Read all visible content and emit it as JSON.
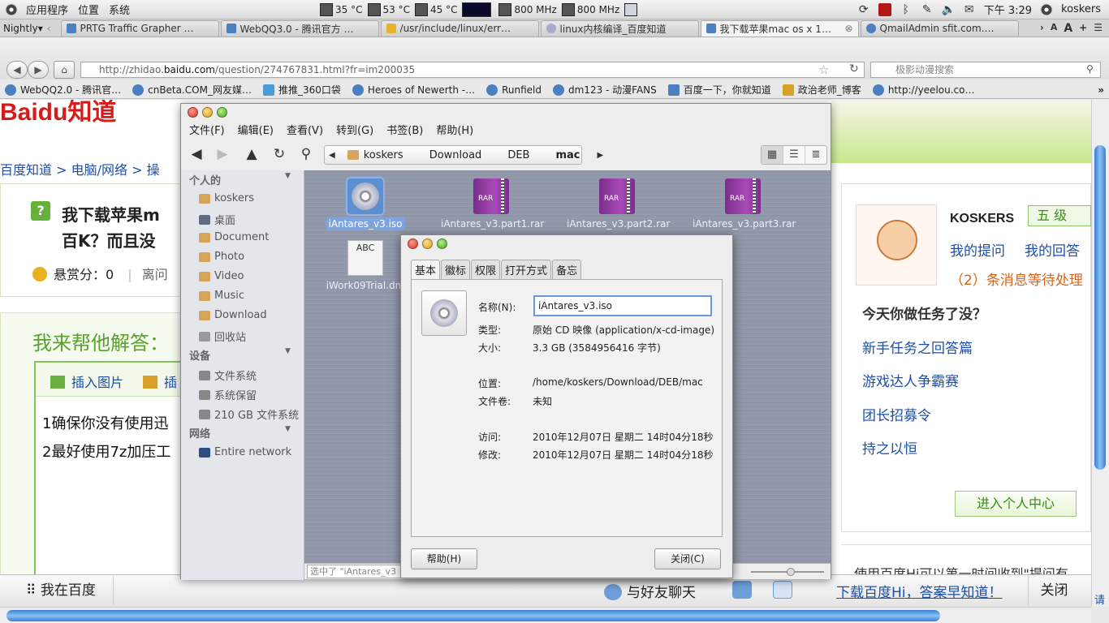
{
  "panel": {
    "menus": [
      "应用程序",
      "位置",
      "系统"
    ],
    "cpu_temp1": "35 °C",
    "cpu_temp2": "53 °C",
    "cpu_temp3": "45 °C",
    "freq1": "800 MHz",
    "freq2": "800 MHz",
    "clock": "下午 3:29",
    "user": "koskers"
  },
  "firefox": {
    "app_button": "Nightly",
    "tabs": [
      {
        "title": "PRTG Traffic Grapher …"
      },
      {
        "title": "WebQQ3.0 - 腾讯官方 …"
      },
      {
        "title": "/usr/include/linux/err…"
      },
      {
        "title": "linux内核编译_百度知道"
      },
      {
        "title": "我下载苹果mac os x 1…",
        "active": true
      },
      {
        "title": "QmailAdmin sfit.com.…"
      }
    ],
    "tab_tools": [
      "A",
      "A",
      "+"
    ],
    "url_prefix": "http://zhidao.",
    "url_domain": "baidu.com",
    "url_suffix": "/question/274767831.html?fr=im200035",
    "search_placeholder": "极影动漫搜索",
    "bookmarks": [
      "WebQQ2.0 - 腾讯官…",
      "cnBeta.COM_网友媒…",
      "推推_360口袋",
      "Heroes of Newerth -…",
      "Runfield",
      "dm123 - 动漫FANS",
      "百度一下，你就知道",
      "政治老师_博客",
      "http://yeelou.co…"
    ]
  },
  "baidu": {
    "logo": "Baidu知道",
    "breadcrumb": [
      "百度知道",
      "电脑/网络",
      "操"
    ],
    "question_title_l1": "我下载苹果m",
    "question_title_l2": "百K？而且没",
    "reward_label": "悬赏分：",
    "reward_value": "0",
    "reward_extra": "离问",
    "help_heading": "我来帮他解答：",
    "insert_image": "插入图片",
    "insert_more": "插",
    "answer_lines": [
      "1确保你没有使用迅",
      "2最好使用7z加压工"
    ],
    "user_name": "KOSKERS",
    "user_level": "五 级",
    "my_questions": "我的提问",
    "my_answers": "我的回答",
    "message_wait": "（2）条消息等待处理",
    "task_heading": "今天你做任务了没？",
    "tasks": [
      "新手任务之回答篇",
      "游戏达人争霸赛",
      "团长招募令",
      "持之以恒"
    ],
    "enter_center": "进入个人中心",
    "hi_text": "使用百度Hi可以第一时间收到\"提问有",
    "hibar_left": "我在百度",
    "hibar_chat": "与好友聊天",
    "hibar_download": "下载百度Hi，答案早知道！",
    "hibar_close": "关闭",
    "hibar_fragment": "请"
  },
  "nautilus": {
    "menu": [
      "文件(F)",
      "编辑(E)",
      "查看(V)",
      "转到(G)",
      "书签(B)",
      "帮助(H)"
    ],
    "path": [
      "koskers",
      "Download",
      "DEB",
      "mac"
    ],
    "sidebar": {
      "personal_header": "个人的",
      "personal": [
        "koskers",
        "桌面",
        "Document",
        "Photo",
        "Video",
        "Music",
        "Download",
        "回收站"
      ],
      "devices_header": "设备",
      "devices": [
        "文件系统",
        "系统保留",
        "210 GB 文件系统"
      ],
      "network_header": "网络",
      "network": [
        "Entire network"
      ]
    },
    "files": [
      {
        "name": "iAntares_v3.iso",
        "kind": "iso",
        "selected": true
      },
      {
        "name": "iAntares_v3.part1.rar",
        "kind": "rar"
      },
      {
        "name": "iAntares_v3.part2.rar",
        "kind": "rar"
      },
      {
        "name": "iAntares_v3.part3.rar",
        "kind": "rar"
      },
      {
        "name": "iWork09Trial.dm",
        "kind": "dmg",
        "icon_text": "ABC"
      }
    ],
    "rar_label": "RAR",
    "status": "选中了 \"iAntares_v3"
  },
  "properties": {
    "tabs": [
      "基本",
      "徽标",
      "权限",
      "打开方式",
      "备忘"
    ],
    "name_label": "名称(N):",
    "name_value": "iAntares_v3.iso",
    "type_label": "类型:",
    "type_value": "原始 CD 映像 (application/x-cd-image)",
    "size_label": "大小:",
    "size_value": "3.3 GB (3584956416 字节)",
    "location_label": "位置:",
    "location_value": "/home/koskers/Download/DEB/mac",
    "volume_label": "文件卷:",
    "volume_value": "未知",
    "accessed_label": "访问:",
    "accessed_value": "2010年12月07日 星期二 14时04分18秒",
    "modified_label": "修改:",
    "modified_value": "2010年12月07日 星期二 14时04分18秒",
    "help_button": "帮助(H)",
    "close_button": "关闭(C)"
  }
}
